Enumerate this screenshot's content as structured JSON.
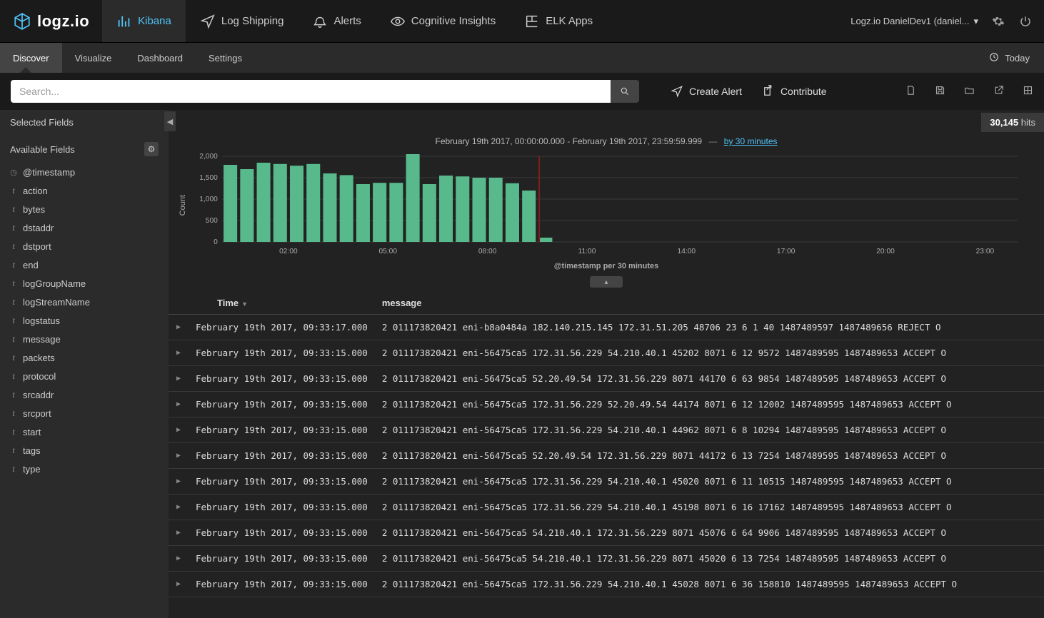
{
  "brand": "logz.io",
  "topnav": {
    "items": [
      {
        "label": "Kibana",
        "active": true
      },
      {
        "label": "Log Shipping"
      },
      {
        "label": "Alerts"
      },
      {
        "label": "Cognitive Insights"
      },
      {
        "label": "ELK Apps"
      }
    ],
    "account": "Logz.io DanielDev1 (daniel..."
  },
  "subnav": {
    "items": [
      {
        "label": "Discover",
        "active": true
      },
      {
        "label": "Visualize"
      },
      {
        "label": "Dashboard"
      },
      {
        "label": "Settings"
      }
    ],
    "time_label": "Today"
  },
  "search": {
    "placeholder": "Search..."
  },
  "actions": {
    "create_alert": "Create Alert",
    "contribute": "Contribute"
  },
  "hits": {
    "count": "30,145",
    "label": "hits"
  },
  "time_caption": {
    "range": "February 19th 2017, 00:00:00.000 - February 19th 2017, 23:59:59.999",
    "link": "by 30 minutes"
  },
  "fields": {
    "selected_header": "Selected Fields",
    "available_header": "Available Fields",
    "special": [
      {
        "name": "@timestamp",
        "type": "clock"
      }
    ],
    "list": [
      "action",
      "bytes",
      "dstaddr",
      "dstport",
      "end",
      "logGroupName",
      "logStreamName",
      "logstatus",
      "message",
      "packets",
      "protocol",
      "srcaddr",
      "srcport",
      "start",
      "tags",
      "type"
    ]
  },
  "chart_data": {
    "type": "bar",
    "ylabel": "Count",
    "xlabel": "@timestamp per 30 minutes",
    "ylim": [
      0,
      2000
    ],
    "yticks": [
      0,
      500,
      1000,
      1500,
      2000
    ],
    "x_start_hours": 0,
    "x_end_hours": 24,
    "xticks_hours": [
      2,
      5,
      8,
      11,
      14,
      17,
      20,
      23
    ],
    "xtick_labels": [
      "02:00",
      "05:00",
      "08:00",
      "11:00",
      "14:00",
      "17:00",
      "20:00",
      "23:00"
    ],
    "interval_minutes": 30,
    "now_marker_hours": 9.56,
    "values": [
      1800,
      1700,
      1850,
      1820,
      1780,
      1820,
      1600,
      1560,
      1350,
      1380,
      1380,
      2050,
      1350,
      1550,
      1530,
      1500,
      1500,
      1370,
      1200,
      100
    ]
  },
  "table": {
    "columns": [
      "Time",
      "message"
    ],
    "rows": [
      {
        "time": "February 19th 2017, 09:33:17.000",
        "msg": "2 011173820421 eni-b8a0484a 182.140.215.145 172.31.51.205 48706 23 6 1 40 1487489597 1487489656 REJECT O"
      },
      {
        "time": "February 19th 2017, 09:33:15.000",
        "msg": "2 011173820421 eni-56475ca5 172.31.56.229 54.210.40.1 45202 8071 6 12 9572 1487489595 1487489653 ACCEPT O"
      },
      {
        "time": "February 19th 2017, 09:33:15.000",
        "msg": "2 011173820421 eni-56475ca5 52.20.49.54 172.31.56.229 8071 44170 6 63 9854 1487489595 1487489653 ACCEPT O"
      },
      {
        "time": "February 19th 2017, 09:33:15.000",
        "msg": "2 011173820421 eni-56475ca5 172.31.56.229 52.20.49.54 44174 8071 6 12 12002 1487489595 1487489653 ACCEPT O"
      },
      {
        "time": "February 19th 2017, 09:33:15.000",
        "msg": "2 011173820421 eni-56475ca5 172.31.56.229 54.210.40.1 44962 8071 6 8 10294 1487489595 1487489653 ACCEPT O"
      },
      {
        "time": "February 19th 2017, 09:33:15.000",
        "msg": "2 011173820421 eni-56475ca5 52.20.49.54 172.31.56.229 8071 44172 6 13 7254 1487489595 1487489653 ACCEPT O"
      },
      {
        "time": "February 19th 2017, 09:33:15.000",
        "msg": "2 011173820421 eni-56475ca5 172.31.56.229 54.210.40.1 45020 8071 6 11 10515 1487489595 1487489653 ACCEPT O"
      },
      {
        "time": "February 19th 2017, 09:33:15.000",
        "msg": "2 011173820421 eni-56475ca5 172.31.56.229 54.210.40.1 45198 8071 6 16 17162 1487489595 1487489653 ACCEPT O"
      },
      {
        "time": "February 19th 2017, 09:33:15.000",
        "msg": "2 011173820421 eni-56475ca5 54.210.40.1 172.31.56.229 8071 45076 6 64 9906 1487489595 1487489653 ACCEPT O"
      },
      {
        "time": "February 19th 2017, 09:33:15.000",
        "msg": "2 011173820421 eni-56475ca5 54.210.40.1 172.31.56.229 8071 45020 6 13 7254 1487489595 1487489653 ACCEPT O"
      },
      {
        "time": "February 19th 2017, 09:33:15.000",
        "msg": "2 011173820421 eni-56475ca5 172.31.56.229 54.210.40.1 45028 8071 6 36 158810 1487489595 1487489653 ACCEPT O"
      }
    ]
  }
}
